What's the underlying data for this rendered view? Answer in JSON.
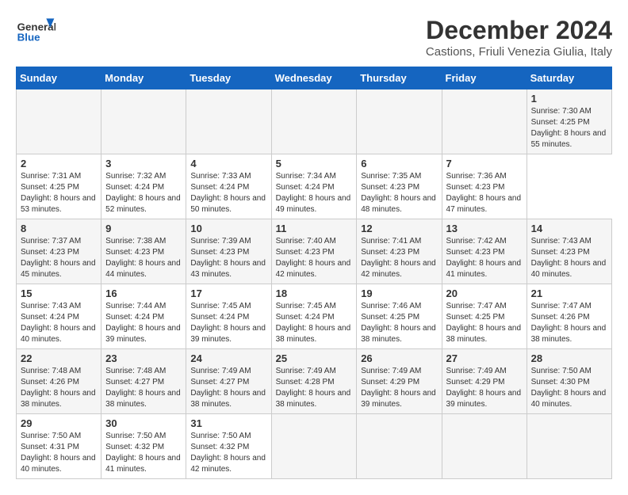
{
  "header": {
    "logo_text_general": "General",
    "logo_text_blue": "Blue",
    "main_title": "December 2024",
    "sub_title": "Castions, Friuli Venezia Giulia, Italy"
  },
  "calendar": {
    "days_of_week": [
      "Sunday",
      "Monday",
      "Tuesday",
      "Wednesday",
      "Thursday",
      "Friday",
      "Saturday"
    ],
    "weeks": [
      [
        null,
        null,
        null,
        null,
        null,
        null,
        {
          "day": "1",
          "sunrise": "Sunrise: 7:30 AM",
          "sunset": "Sunset: 4:25 PM",
          "daylight": "Daylight: 8 hours and 55 minutes."
        }
      ],
      [
        {
          "day": "2",
          "sunrise": "Sunrise: 7:31 AM",
          "sunset": "Sunset: 4:25 PM",
          "daylight": "Daylight: 8 hours and 53 minutes."
        },
        {
          "day": "3",
          "sunrise": "Sunrise: 7:32 AM",
          "sunset": "Sunset: 4:24 PM",
          "daylight": "Daylight: 8 hours and 52 minutes."
        },
        {
          "day": "4",
          "sunrise": "Sunrise: 7:33 AM",
          "sunset": "Sunset: 4:24 PM",
          "daylight": "Daylight: 8 hours and 50 minutes."
        },
        {
          "day": "5",
          "sunrise": "Sunrise: 7:34 AM",
          "sunset": "Sunset: 4:24 PM",
          "daylight": "Daylight: 8 hours and 49 minutes."
        },
        {
          "day": "6",
          "sunrise": "Sunrise: 7:35 AM",
          "sunset": "Sunset: 4:23 PM",
          "daylight": "Daylight: 8 hours and 48 minutes."
        },
        {
          "day": "7",
          "sunrise": "Sunrise: 7:36 AM",
          "sunset": "Sunset: 4:23 PM",
          "daylight": "Daylight: 8 hours and 47 minutes."
        }
      ],
      [
        {
          "day": "8",
          "sunrise": "Sunrise: 7:37 AM",
          "sunset": "Sunset: 4:23 PM",
          "daylight": "Daylight: 8 hours and 45 minutes."
        },
        {
          "day": "9",
          "sunrise": "Sunrise: 7:38 AM",
          "sunset": "Sunset: 4:23 PM",
          "daylight": "Daylight: 8 hours and 44 minutes."
        },
        {
          "day": "10",
          "sunrise": "Sunrise: 7:39 AM",
          "sunset": "Sunset: 4:23 PM",
          "daylight": "Daylight: 8 hours and 43 minutes."
        },
        {
          "day": "11",
          "sunrise": "Sunrise: 7:40 AM",
          "sunset": "Sunset: 4:23 PM",
          "daylight": "Daylight: 8 hours and 42 minutes."
        },
        {
          "day": "12",
          "sunrise": "Sunrise: 7:41 AM",
          "sunset": "Sunset: 4:23 PM",
          "daylight": "Daylight: 8 hours and 42 minutes."
        },
        {
          "day": "13",
          "sunrise": "Sunrise: 7:42 AM",
          "sunset": "Sunset: 4:23 PM",
          "daylight": "Daylight: 8 hours and 41 minutes."
        },
        {
          "day": "14",
          "sunrise": "Sunrise: 7:43 AM",
          "sunset": "Sunset: 4:23 PM",
          "daylight": "Daylight: 8 hours and 40 minutes."
        }
      ],
      [
        {
          "day": "15",
          "sunrise": "Sunrise: 7:43 AM",
          "sunset": "Sunset: 4:24 PM",
          "daylight": "Daylight: 8 hours and 40 minutes."
        },
        {
          "day": "16",
          "sunrise": "Sunrise: 7:44 AM",
          "sunset": "Sunset: 4:24 PM",
          "daylight": "Daylight: 8 hours and 39 minutes."
        },
        {
          "day": "17",
          "sunrise": "Sunrise: 7:45 AM",
          "sunset": "Sunset: 4:24 PM",
          "daylight": "Daylight: 8 hours and 39 minutes."
        },
        {
          "day": "18",
          "sunrise": "Sunrise: 7:45 AM",
          "sunset": "Sunset: 4:24 PM",
          "daylight": "Daylight: 8 hours and 38 minutes."
        },
        {
          "day": "19",
          "sunrise": "Sunrise: 7:46 AM",
          "sunset": "Sunset: 4:25 PM",
          "daylight": "Daylight: 8 hours and 38 minutes."
        },
        {
          "day": "20",
          "sunrise": "Sunrise: 7:47 AM",
          "sunset": "Sunset: 4:25 PM",
          "daylight": "Daylight: 8 hours and 38 minutes."
        },
        {
          "day": "21",
          "sunrise": "Sunrise: 7:47 AM",
          "sunset": "Sunset: 4:26 PM",
          "daylight": "Daylight: 8 hours and 38 minutes."
        }
      ],
      [
        {
          "day": "22",
          "sunrise": "Sunrise: 7:48 AM",
          "sunset": "Sunset: 4:26 PM",
          "daylight": "Daylight: 8 hours and 38 minutes."
        },
        {
          "day": "23",
          "sunrise": "Sunrise: 7:48 AM",
          "sunset": "Sunset: 4:27 PM",
          "daylight": "Daylight: 8 hours and 38 minutes."
        },
        {
          "day": "24",
          "sunrise": "Sunrise: 7:49 AM",
          "sunset": "Sunset: 4:27 PM",
          "daylight": "Daylight: 8 hours and 38 minutes."
        },
        {
          "day": "25",
          "sunrise": "Sunrise: 7:49 AM",
          "sunset": "Sunset: 4:28 PM",
          "daylight": "Daylight: 8 hours and 38 minutes."
        },
        {
          "day": "26",
          "sunrise": "Sunrise: 7:49 AM",
          "sunset": "Sunset: 4:29 PM",
          "daylight": "Daylight: 8 hours and 39 minutes."
        },
        {
          "day": "27",
          "sunrise": "Sunrise: 7:49 AM",
          "sunset": "Sunset: 4:29 PM",
          "daylight": "Daylight: 8 hours and 39 minutes."
        },
        {
          "day": "28",
          "sunrise": "Sunrise: 7:50 AM",
          "sunset": "Sunset: 4:30 PM",
          "daylight": "Daylight: 8 hours and 40 minutes."
        }
      ],
      [
        {
          "day": "29",
          "sunrise": "Sunrise: 7:50 AM",
          "sunset": "Sunset: 4:31 PM",
          "daylight": "Daylight: 8 hours and 40 minutes."
        },
        {
          "day": "30",
          "sunrise": "Sunrise: 7:50 AM",
          "sunset": "Sunset: 4:32 PM",
          "daylight": "Daylight: 8 hours and 41 minutes."
        },
        {
          "day": "31",
          "sunrise": "Sunrise: 7:50 AM",
          "sunset": "Sunset: 4:32 PM",
          "daylight": "Daylight: 8 hours and 42 minutes."
        },
        null,
        null,
        null,
        null
      ]
    ]
  }
}
